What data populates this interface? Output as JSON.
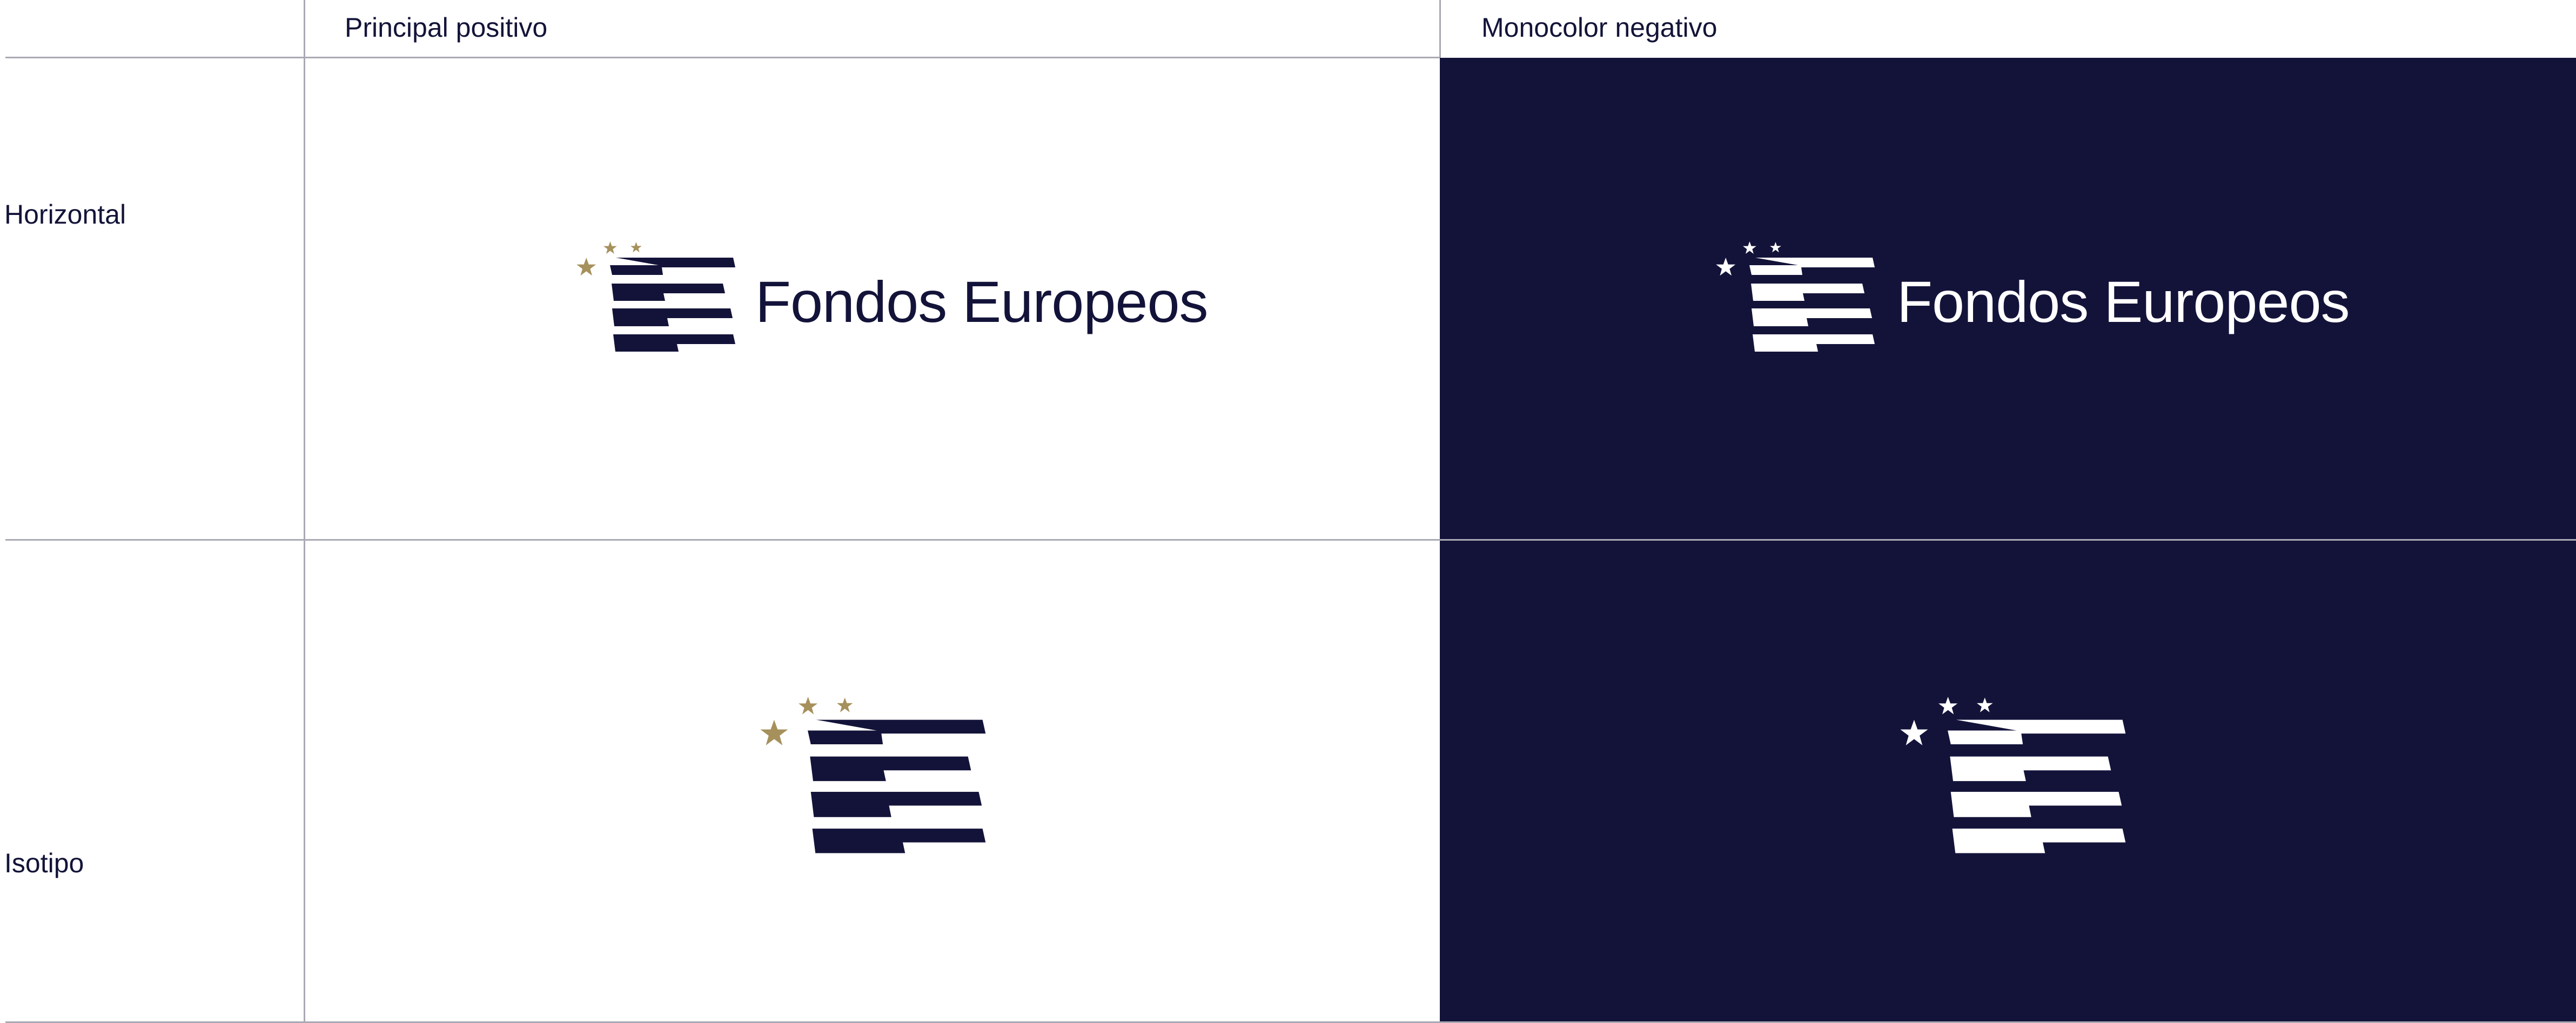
{
  "columns": {
    "principal": "Principal positivo",
    "monocolor": "Monocolor negativo"
  },
  "rows": {
    "horizontal": "Horizontal",
    "isotipo": "Isotipo"
  },
  "brand": {
    "name": "Fondos Europeos"
  },
  "colors": {
    "navy": "#13133a",
    "gold": "#a6915c",
    "white": "#ffffff",
    "grid_line": "#a9a9b4"
  },
  "icons": [
    "gold-stars-icon",
    "white-stars-icon",
    "stripes-e-mark-icon"
  ]
}
